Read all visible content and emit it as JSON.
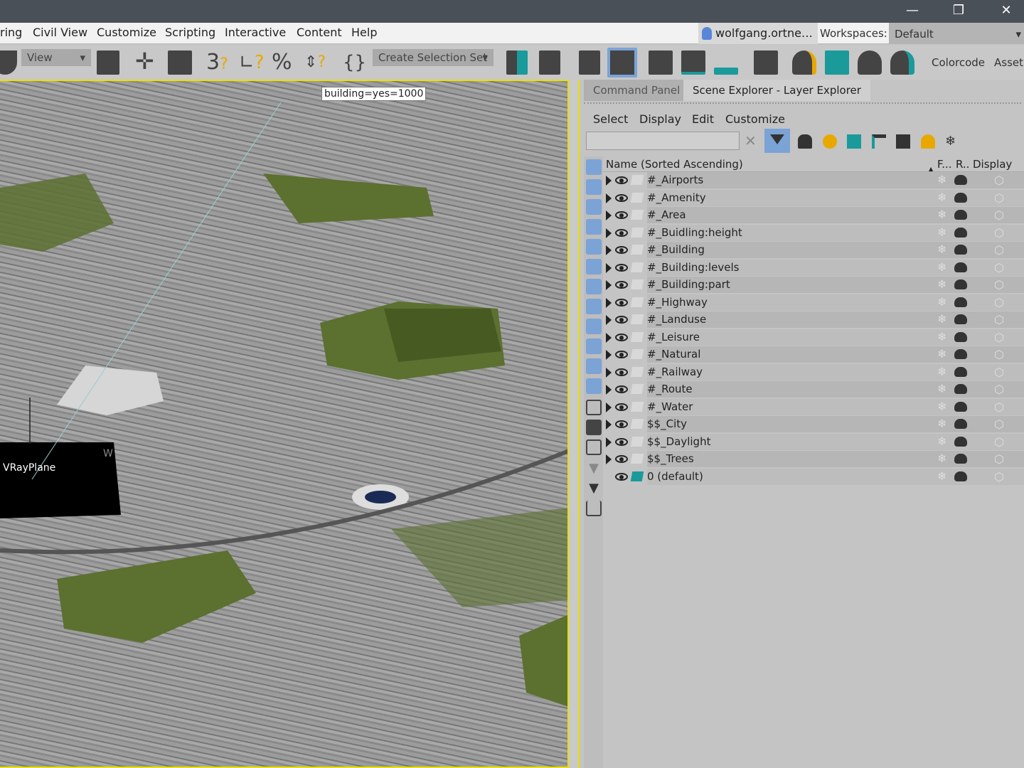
{
  "window": {
    "minimize": "—",
    "restore": "❐",
    "close": "✕"
  },
  "menu": [
    "ring",
    "Civil View",
    "Customize",
    "Scripting",
    "Interactive",
    "Content",
    "Help"
  ],
  "user": {
    "name": "wolfgang.ortne…▾"
  },
  "workspaces": {
    "label": "Workspaces:",
    "value": "Default"
  },
  "toolbar": {
    "view_dropdown": "View",
    "selection_set": "Create Selection Set",
    "colorcode": "Colorcode",
    "asset": "AssetB"
  },
  "viewport": {
    "tooltip": "building=yes=1000",
    "object_label": "VRayPlane",
    "axis_label": "W"
  },
  "panel": {
    "tabs": [
      "Command Panel",
      "Scene Explorer - Layer Explorer"
    ],
    "menus": [
      "Select",
      "Display",
      "Edit",
      "Customize"
    ],
    "search_value": "",
    "columns": {
      "name": "Name (Sorted Ascending)",
      "frozen": "F...",
      "render": "R..",
      "display": "Display a..."
    },
    "layers": [
      "#_Airports",
      "#_Amenity",
      "#_Area",
      "#_Buidling:height",
      "#_Building",
      "#_Building:levels",
      "#_Building:part",
      "#_Highway",
      "#_Landuse",
      "#_Leisure",
      "#_Natural",
      "#_Railway",
      "#_Route",
      "#_Water",
      "$$_City",
      "$$_Daylight",
      "$$_Trees"
    ],
    "default_layer": "0 (default)"
  },
  "colors": {
    "accent": "#e8e000",
    "teal": "#1a9a9a",
    "selected": "#7ba3d6",
    "park": "#5c7030"
  }
}
